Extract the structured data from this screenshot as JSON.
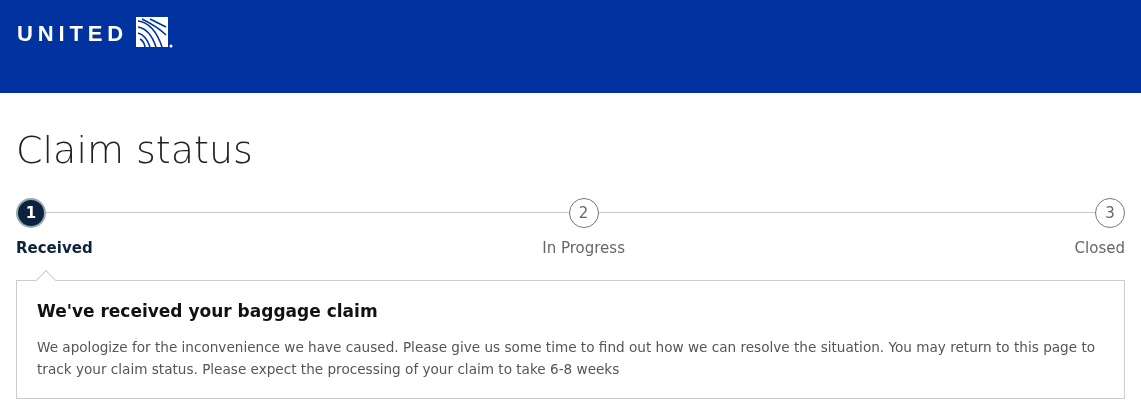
{
  "header": {
    "logo_text": "UNITED"
  },
  "title": "Claim status",
  "steps": [
    {
      "number": "1",
      "label": "Received",
      "selected": true
    },
    {
      "number": "2",
      "label": "In Progress",
      "selected": false
    },
    {
      "number": "3",
      "label": "Closed",
      "selected": false
    }
  ],
  "card": {
    "heading": "We've received your baggage claim",
    "body": "We apologize for the inconvenience we have caused. Please give us some time to find out how we can resolve the situation. You may return to this page to track your claim status. Please expect the processing of your claim to take 6-8 weeks"
  }
}
